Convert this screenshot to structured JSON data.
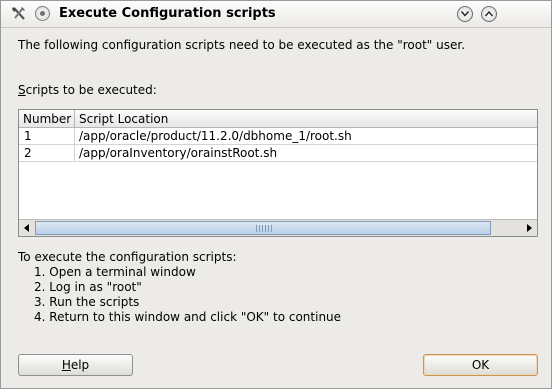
{
  "window": {
    "title": "Execute Configuration scripts"
  },
  "message": "The following configuration scripts need to be executed as the \"root\" user.",
  "scripts_label": {
    "mnemonic": "S",
    "rest": "cripts to be executed:"
  },
  "table": {
    "columns": [
      "Number",
      "Script Location"
    ],
    "rows": [
      {
        "number": "1",
        "location": "/app/oracle/product/11.2.0/dbhome_1/root.sh"
      },
      {
        "number": "2",
        "location": "/app/oraInventory/orainstRoot.sh"
      }
    ],
    "horizontal_scroll_position": 0
  },
  "instructions": {
    "heading": "To execute the configuration scripts:",
    "steps": [
      "1. Open a terminal window",
      "2. Log in as \"root\"",
      "3. Run the scripts",
      "4. Return to this window and click \"OK\" to continue"
    ]
  },
  "buttons": {
    "help": {
      "mnemonic": "H",
      "rest": "elp"
    },
    "ok": "OK"
  },
  "icons": {
    "app": "tools-icon",
    "window_menu": "window-menu-icon",
    "minimize": "minimize-icon",
    "maximize": "maximize-icon",
    "scroll_left": "arrow-left-icon",
    "scroll_right": "arrow-right-icon"
  },
  "colors": {
    "window_bg": "#ecebe8",
    "ok_border": "#c9955b",
    "scroll_thumb": "#b9cfe6"
  }
}
